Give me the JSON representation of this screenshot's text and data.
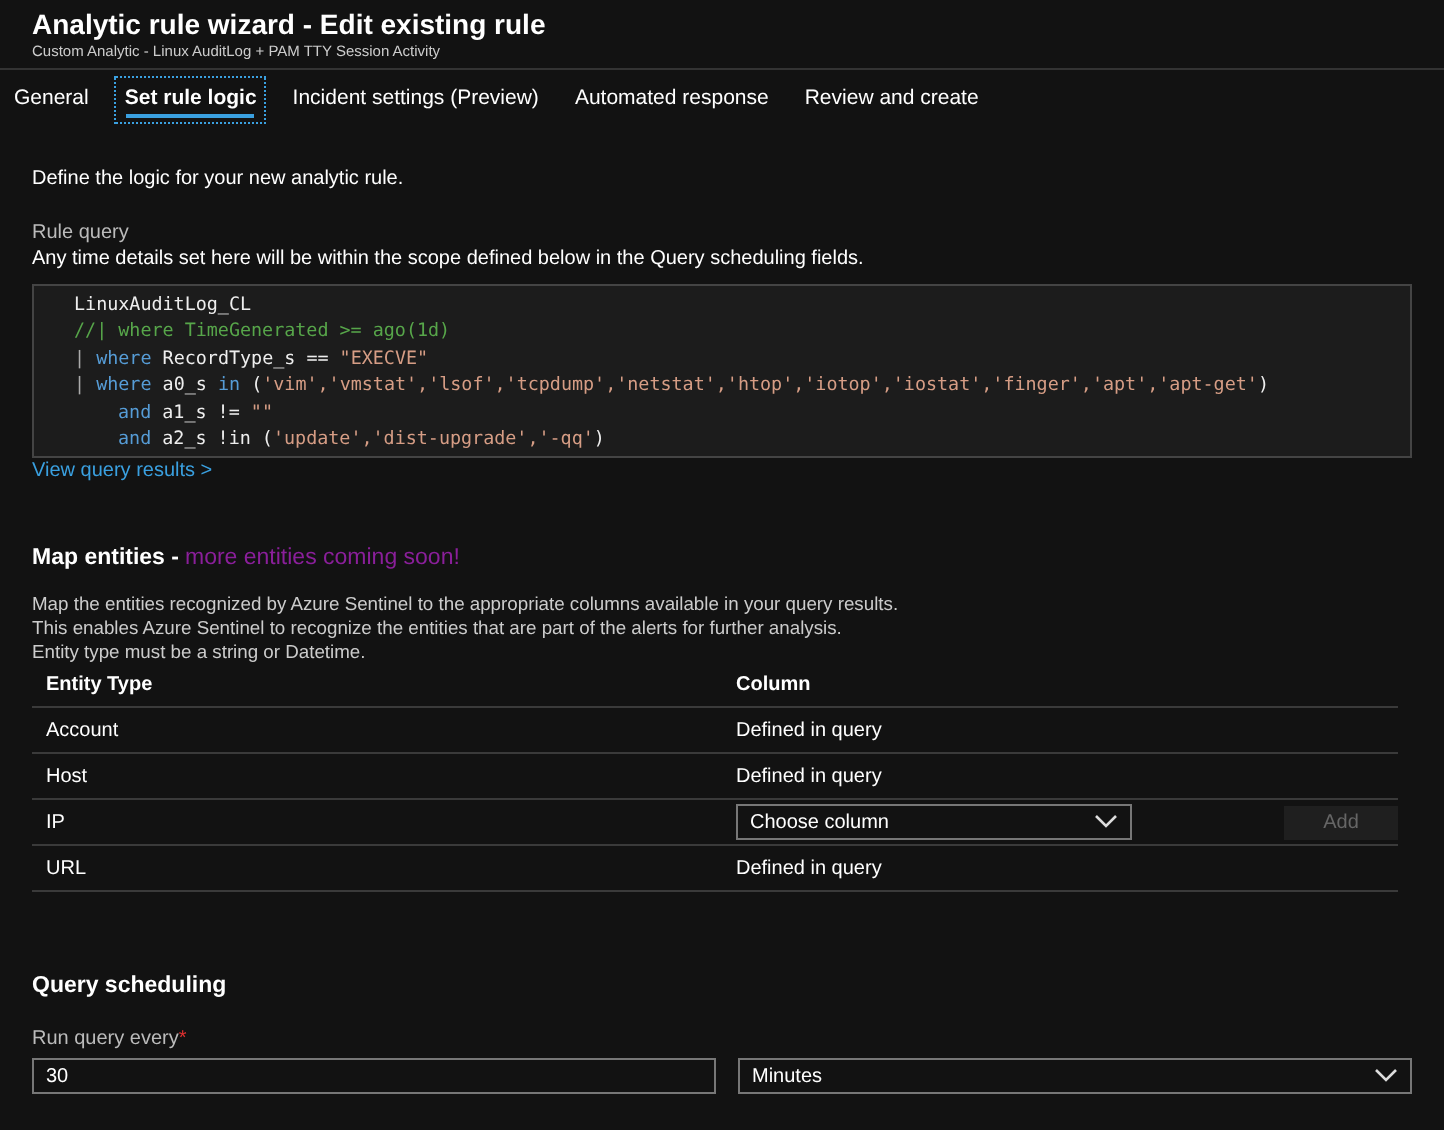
{
  "header": {
    "title": "Analytic rule wizard - Edit existing rule",
    "subtitle": "Custom Analytic - Linux AuditLog + PAM TTY Session Activity"
  },
  "tabs": [
    {
      "label": "General",
      "selected": false
    },
    {
      "label": "Set rule logic",
      "selected": true
    },
    {
      "label": "Incident settings (Preview)",
      "selected": false
    },
    {
      "label": "Automated response",
      "selected": false
    },
    {
      "label": "Review and create",
      "selected": false
    }
  ],
  "intro": "Define the logic for your new analytic rule.",
  "rule_query": {
    "label": "Rule query",
    "hint": "Any time details set here will be within the scope defined below in the Query scheduling fields.",
    "lines": [
      {
        "indented": false,
        "tokens": [
          {
            "kind": "plain",
            "text": "LinuxAuditLog_CL"
          }
        ]
      },
      {
        "indented": false,
        "tokens": [
          {
            "kind": "comment",
            "text": "//| where TimeGenerated >= ago(1d)"
          }
        ]
      },
      {
        "indented": false,
        "tokens": [
          {
            "kind": "pipe",
            "text": "| "
          },
          {
            "kind": "keyword",
            "text": "where"
          },
          {
            "kind": "plain",
            "text": " RecordType_s == "
          },
          {
            "kind": "string",
            "text": "\"EXECVE\""
          }
        ]
      },
      {
        "indented": false,
        "tokens": [
          {
            "kind": "pipe",
            "text": "| "
          },
          {
            "kind": "keyword",
            "text": "where"
          },
          {
            "kind": "plain",
            "text": " a0_s "
          },
          {
            "kind": "keyword",
            "text": "in"
          },
          {
            "kind": "plain",
            "text": " ("
          },
          {
            "kind": "string",
            "text": "'vim','vmstat','lsof','tcpdump','netstat','htop','iotop','iostat','finger','apt','apt-get'"
          },
          {
            "kind": "plain",
            "text": ")"
          }
        ]
      },
      {
        "indented": true,
        "tokens": [
          {
            "kind": "keyword",
            "text": "and"
          },
          {
            "kind": "plain",
            "text": " a1_s != "
          },
          {
            "kind": "string",
            "text": "\"\""
          }
        ]
      },
      {
        "indented": true,
        "tokens": [
          {
            "kind": "keyword",
            "text": "and"
          },
          {
            "kind": "plain",
            "text": " a2_s !in ("
          },
          {
            "kind": "string",
            "text": "'update','dist-upgrade','-qq'"
          },
          {
            "kind": "plain",
            "text": ")"
          }
        ]
      }
    ],
    "link": "View query results >"
  },
  "map_entities": {
    "title": "Map entities -",
    "title_note": "more entities coming soon!",
    "description": [
      "Map the entities recognized by Azure Sentinel to the appropriate columns available in your query results.",
      "This enables Azure Sentinel to recognize the entities that are part of the alerts for further analysis.",
      "Entity type must be a string or Datetime."
    ],
    "columns": [
      "Entity Type",
      "Column"
    ],
    "rows": [
      {
        "entity": "Account",
        "kind": "text",
        "column": "Defined in query"
      },
      {
        "entity": "Host",
        "kind": "text",
        "column": "Defined in query"
      },
      {
        "entity": "IP",
        "kind": "dropdown",
        "column": "Choose column",
        "button": {
          "label": "Add",
          "disabled": true
        }
      },
      {
        "entity": "URL",
        "kind": "text",
        "column": "Defined in query"
      }
    ]
  },
  "query_scheduling": {
    "title": "Query scheduling",
    "field": {
      "label": "Run query every",
      "required_mark": "*",
      "value": "30",
      "unit": "Minutes"
    }
  }
}
